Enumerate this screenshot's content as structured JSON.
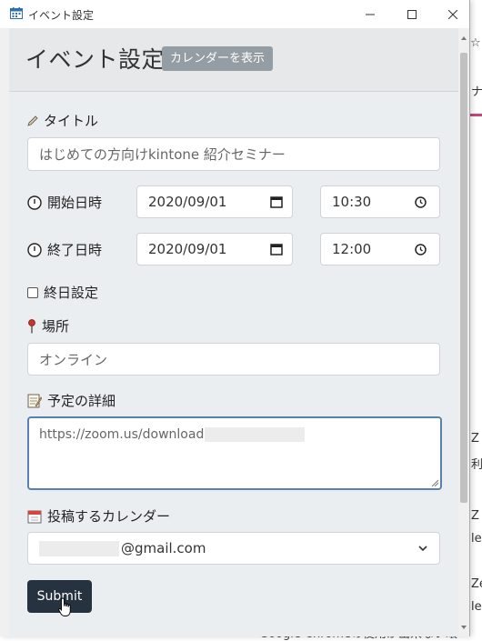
{
  "window": {
    "title": "イベント設定",
    "controls": {
      "minimize": "—",
      "maximize": "☐",
      "close": "✕"
    }
  },
  "header": {
    "title": "イベント設定",
    "badge": "カレンダーを表示"
  },
  "form": {
    "title_label": "タイトル",
    "title_value": "はじめての方向けkintone 紹介セミナー",
    "start_label": "開始日時",
    "start_date": "2020/09/01",
    "start_time": "10:30",
    "end_label": "終了日時",
    "end_date": "2020/09/01",
    "end_time": "12:00",
    "allday_label": "終日設定",
    "place_label": "場所",
    "place_value": "オンライン",
    "detail_label": "予定の詳細",
    "detail_value": "https://zoom.us/download",
    "calendar_label": "投稿するカレンダー",
    "calendar_value": "@gmail.com",
    "submit_label": "Submit"
  },
  "background": {
    "bottom_text": "Google Chromeの使用が出来ない環",
    "frag_top": "☆",
    "frag_1": "ナ",
    "frag_2": "Z",
    "frag_3": "利",
    "frag_4": "Ze",
    "frag_5": "le",
    "frag_6": "Z",
    "frag_7": "le"
  },
  "colors": {
    "accent_border": "#5b7fb0",
    "submit_bg": "#263240",
    "badge_bg": "#949ca4"
  }
}
